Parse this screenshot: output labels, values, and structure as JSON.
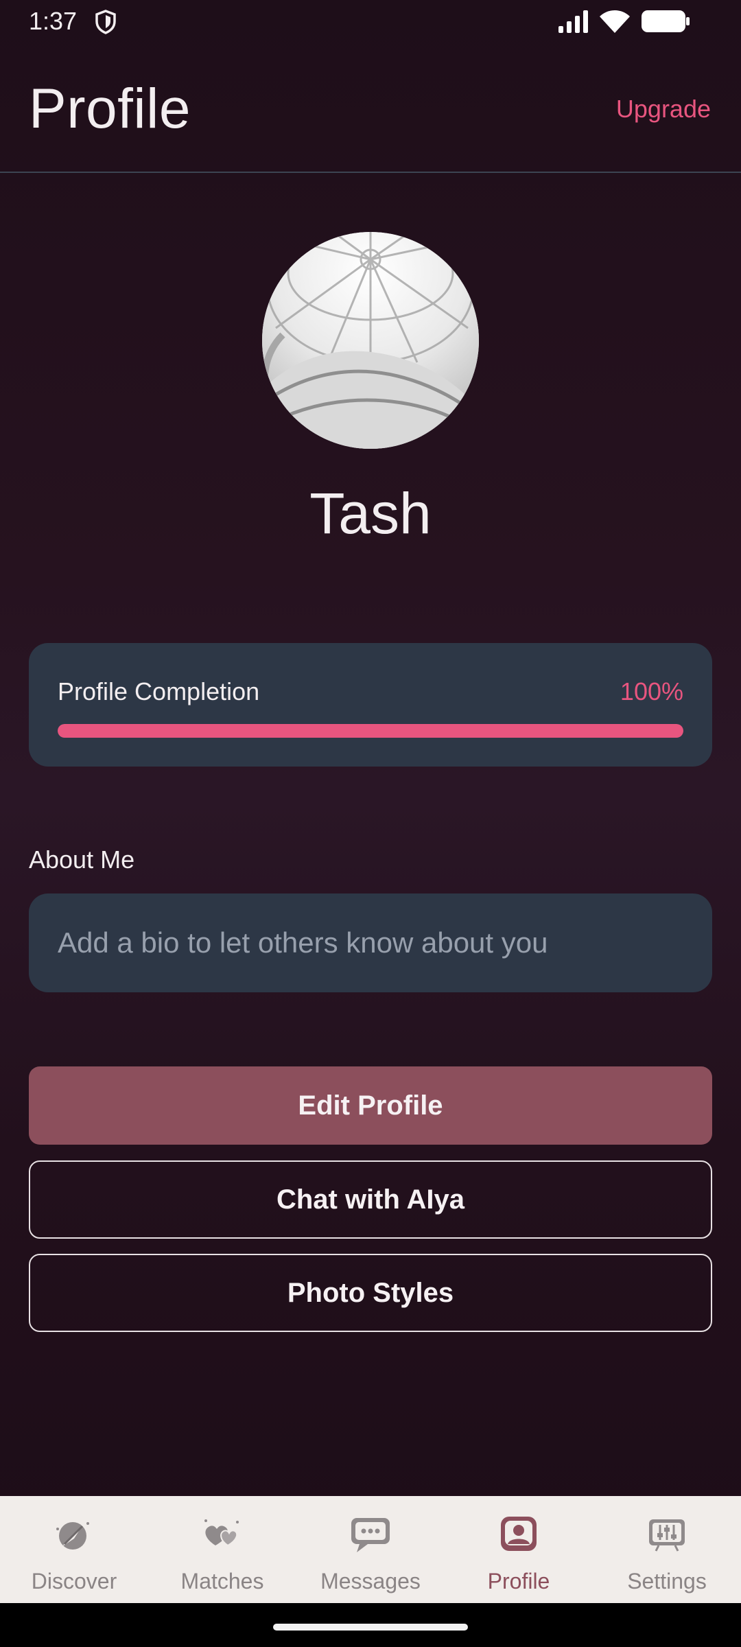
{
  "status_bar": {
    "time": "1:37",
    "icons": [
      "shield-icon",
      "signal-icon",
      "wifi-icon",
      "battery-icon"
    ]
  },
  "header": {
    "title": "Profile",
    "upgrade_label": "Upgrade"
  },
  "profile": {
    "avatar_icon": "avatar",
    "name": "Tash"
  },
  "completion": {
    "label": "Profile Completion",
    "value_text": "100%",
    "progress": 1.0
  },
  "about": {
    "label": "About Me",
    "placeholder": "Add a bio to let others know about you"
  },
  "actions": {
    "edit_profile": "Edit Profile",
    "chat_with_alya": "Chat with AIya",
    "photo_styles": "Photo Styles"
  },
  "bottom_nav": {
    "items": [
      {
        "label": "Discover",
        "icon": "compass-icon",
        "active": false
      },
      {
        "label": "Matches",
        "icon": "hearts-icon",
        "active": false
      },
      {
        "label": "Messages",
        "icon": "chat-bubble-icon",
        "active": false
      },
      {
        "label": "Profile",
        "icon": "profile-icon",
        "active": true
      },
      {
        "label": "Settings",
        "icon": "sliders-icon",
        "active": false
      }
    ]
  },
  "colors": {
    "accent": "#e8557f",
    "primary_button": "#8c4f5c",
    "card": "#2d3746",
    "nav_background": "#f1edea"
  }
}
